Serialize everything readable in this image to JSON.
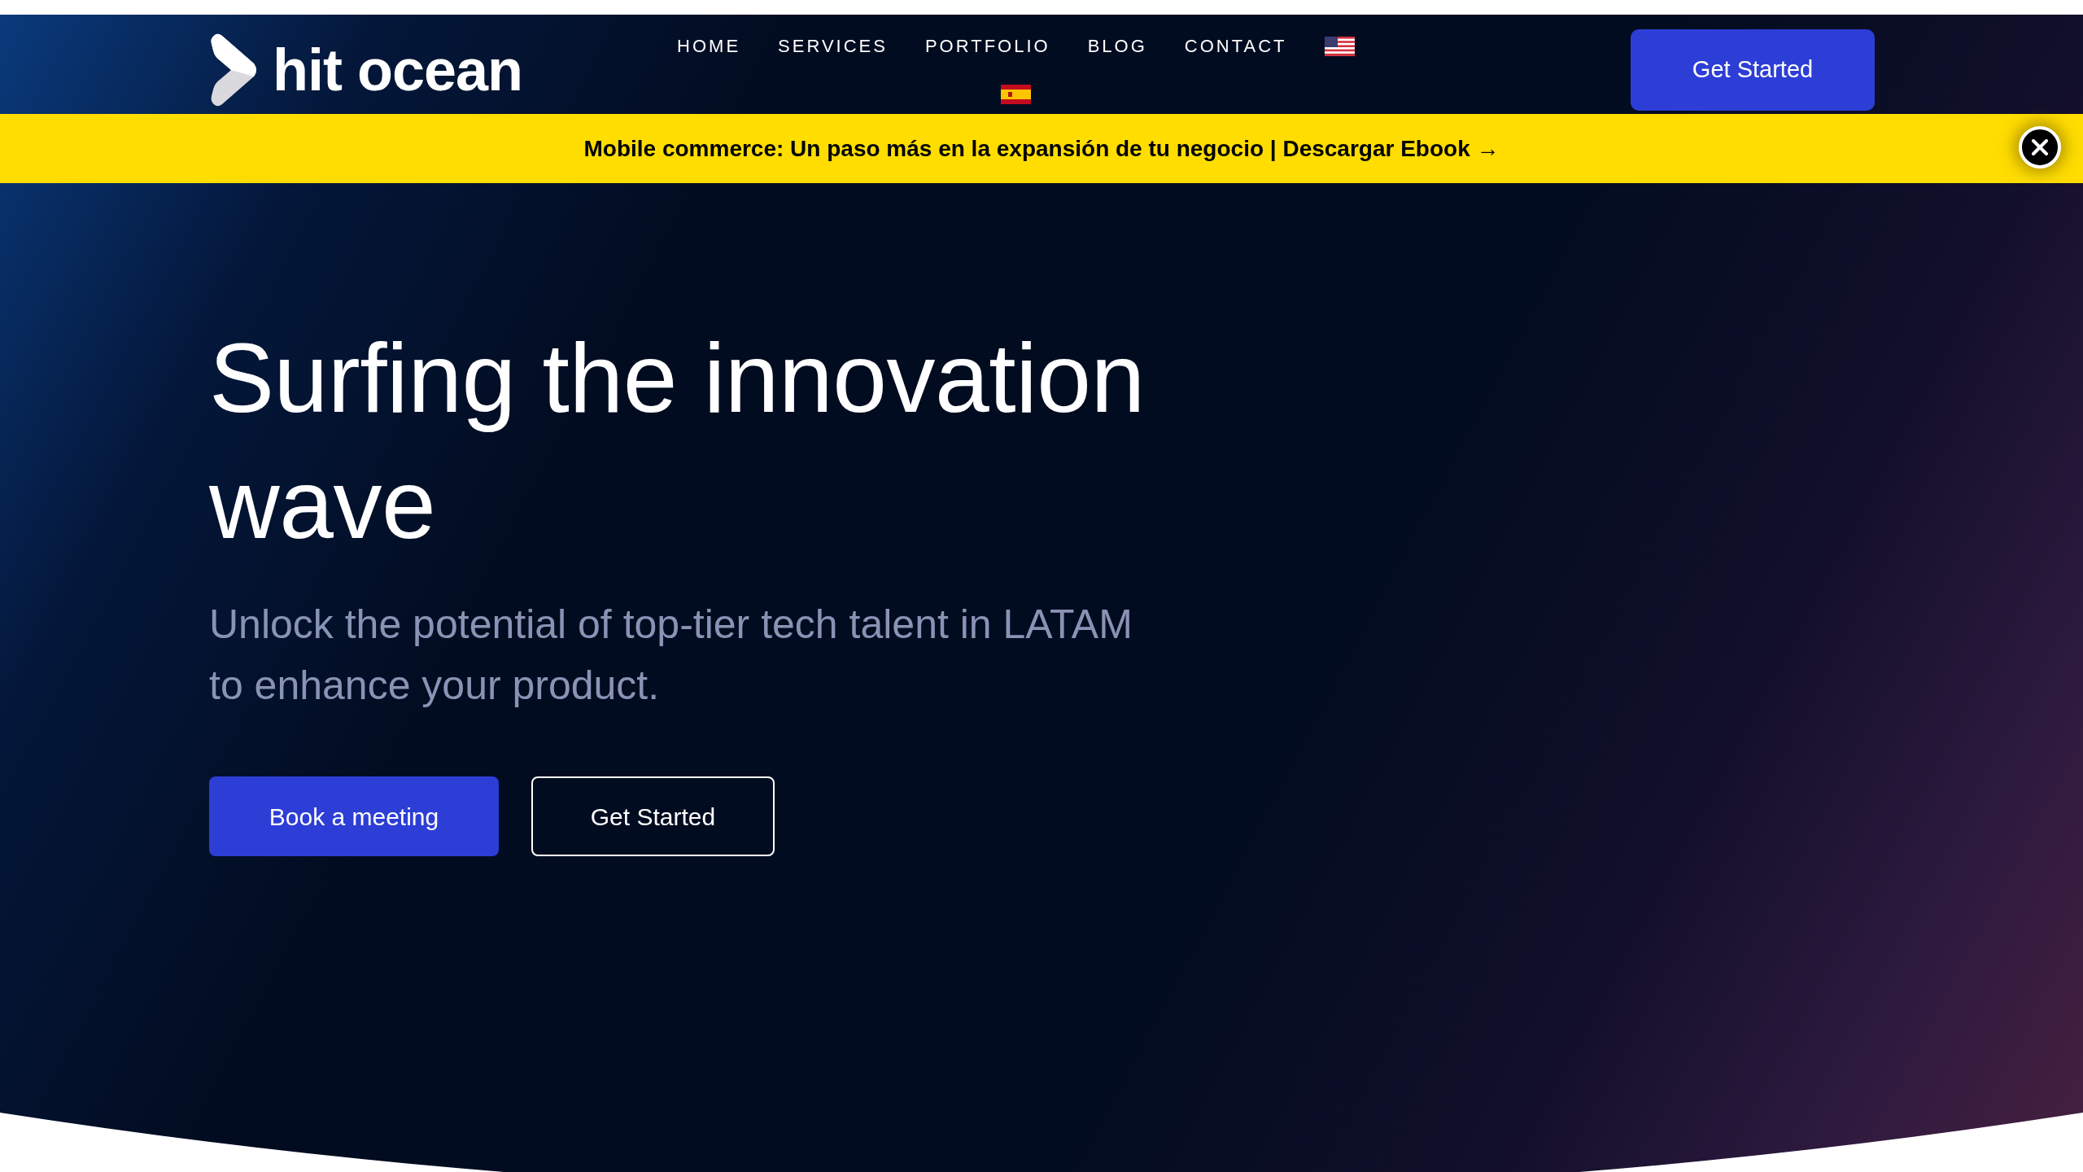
{
  "header": {
    "logo": {
      "text": "hit ocean"
    },
    "nav": [
      "HOME",
      "SERVICES",
      "PORTFOLIO",
      "BLOG",
      "CONTACT"
    ],
    "cta": "Get Started"
  },
  "announcement": {
    "text": "Mobile commerce: Un paso más en la expansión de tu negocio | Descargar Ebook →"
  },
  "hero": {
    "title": "Surfing the innovation wave",
    "subtitle": "Unlock the potential of top-tier tech talent in LATAM to enhance your product.",
    "buttons": [
      {
        "label": "Book a meeting",
        "kind": "primary"
      },
      {
        "label": "Get Started",
        "kind": "outline"
      }
    ]
  }
}
